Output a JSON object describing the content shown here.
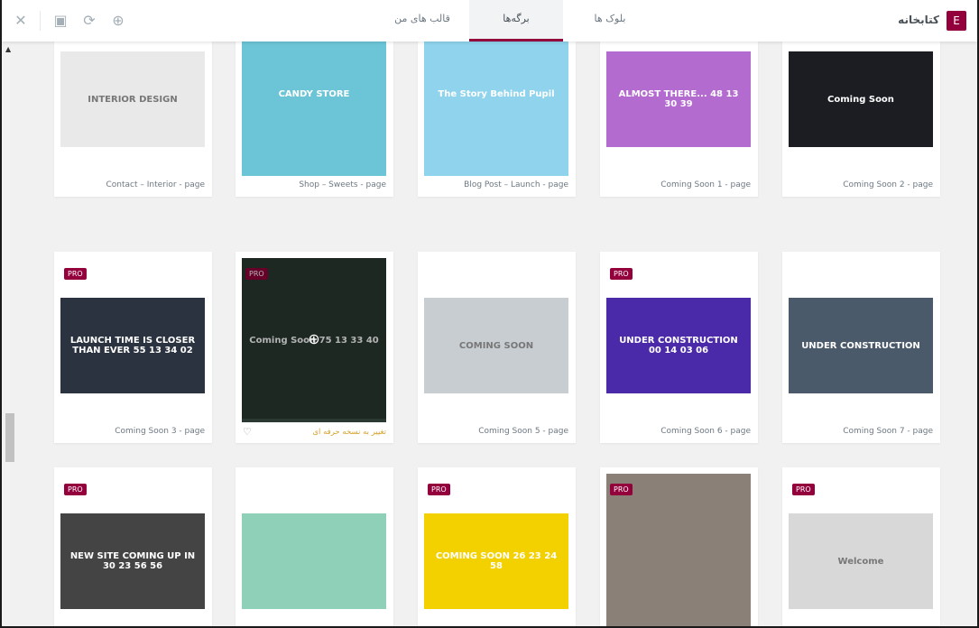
{
  "header": {
    "title": "کتابخانه",
    "logo": "E",
    "tabs": [
      {
        "label": "بلوک ها"
      },
      {
        "label": "برگه‌ها",
        "active": true
      },
      {
        "label": "قالب های من"
      }
    ],
    "icons": [
      "close-icon",
      "save-icon",
      "sync-icon",
      "upload-icon"
    ]
  },
  "accent": "#93003c",
  "pro_badge": "PRO",
  "upgrade_label": "تغییر به نسخه حرفه ای",
  "cards": [
    {
      "label": "Coming Soon 2 - page",
      "pro": false,
      "thumb": "Coming Soon",
      "color": "#1b1d22"
    },
    {
      "label": "Coming Soon 1 - page",
      "pro": true,
      "thumb": "ALMOST THERE... 48 13 30 39",
      "color": "#b46bd0"
    },
    {
      "label": "Blog Post – Launch - page",
      "pro": false,
      "thumb": "The Story Behind Pupil",
      "color": "#8fd4ec"
    },
    {
      "label": "Shop – Sweets - page",
      "pro": false,
      "thumb": "CANDY STORE",
      "color": "#6cc5d6"
    },
    {
      "label": "Contact – Interior - page",
      "pro": true,
      "thumb": "INTERIOR DESIGN",
      "color": "#e9e9e9"
    },
    {
      "label": "Coming Soon 7 - page",
      "pro": false,
      "thumb": "UNDER CONSTRUCTION",
      "color": "#4a5a6a"
    },
    {
      "label": "Coming Soon 6 - page",
      "pro": true,
      "thumb": "UNDER CONSTRUCTION 00 14 03 06",
      "color": "#4a2aa8"
    },
    {
      "label": "Coming Soon 5 - page",
      "pro": false,
      "thumb": "COMING SOON",
      "color": "#c8cdd2"
    },
    {
      "label": "",
      "pro": true,
      "thumb": "Coming Soon 75 13 33 40",
      "color": "#2a3a33",
      "hover": true
    },
    {
      "label": "Coming Soon 3 - page",
      "pro": true,
      "thumb": "LAUNCH TIME IS CLOSER THAN EVER 55 13 34 02",
      "color": "#2b3340"
    },
    {
      "label": "",
      "pro": true,
      "thumb": "Welcome",
      "color": "#d8d8d8"
    },
    {
      "label": "",
      "pro": true,
      "thumb": "",
      "color": "#8a8078"
    },
    {
      "label": "",
      "pro": true,
      "thumb": "COMING SOON 26 23 24 58",
      "color": "#f3d000"
    },
    {
      "label": "",
      "pro": false,
      "thumb": "",
      "color": "#8fd0b8"
    },
    {
      "label": "",
      "pro": true,
      "thumb": "NEW SITE COMING UP IN 30 23 56 56",
      "color": "#444"
    }
  ]
}
